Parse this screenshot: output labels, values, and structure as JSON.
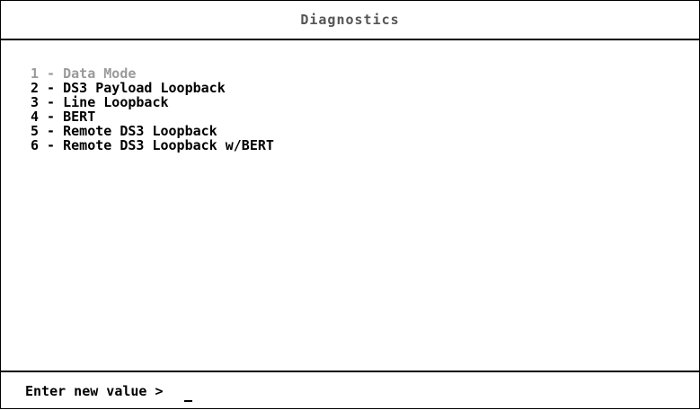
{
  "header": {
    "title": "Diagnostics"
  },
  "menu": {
    "separator": " - ",
    "items": [
      {
        "key": "1",
        "label": "Data Mode",
        "current": true
      },
      {
        "key": "2",
        "label": "DS3 Payload Loopback",
        "current": false
      },
      {
        "key": "3",
        "label": "Line Loopback",
        "current": false
      },
      {
        "key": "4",
        "label": "BERT",
        "current": false
      },
      {
        "key": "5",
        "label": "Remote DS3 Loopback",
        "current": false
      },
      {
        "key": "6",
        "label": "Remote DS3 Loopback w/BERT",
        "current": false
      }
    ]
  },
  "prompt": {
    "label": "Enter new value >",
    "value": ""
  },
  "colors": {
    "title": "#555555",
    "current_item": "#9a9a9a",
    "text": "#000000",
    "background": "#ffffff"
  }
}
